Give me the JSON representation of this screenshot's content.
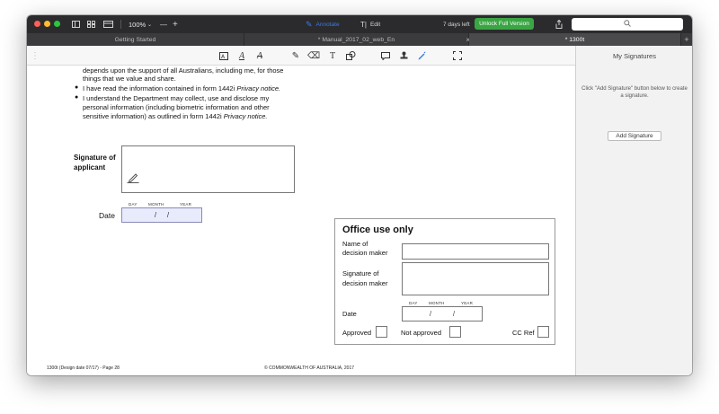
{
  "titlebar": {
    "zoom": "100%",
    "zoom_minus": "—",
    "zoom_plus": "+",
    "annotate_label": "Annotate",
    "edit_label": "Edit",
    "trial_text": "7 days left",
    "unlock_label": "Unlock Full Version",
    "colors": {
      "annotate": "#3c7be0",
      "unlock": "#3aa543"
    }
  },
  "tabs": [
    {
      "label": "Getting Started"
    },
    {
      "label": "* Manual_2017_02_web_En"
    },
    {
      "label": "* 1300t"
    }
  ],
  "tab_close": "×",
  "tab_add": "+",
  "document": {
    "para1_line1": "depends upon the support of all Australians, including me, for those",
    "para1_line2": "things that we value and share.",
    "bullet_char": "●",
    "bullet2_prefix": "I have read the information contained in form 1442i ",
    "bullet2_italic": "Privacy notice.",
    "bullet3_line1": "I understand the Department may collect, use and disclose my",
    "bullet3_line2": "personal information (including biometric information and other",
    "bullet3_line3_prefix": "sensitive information) as outlined in form 1442i ",
    "bullet3_line3_italic": "Privacy notice.",
    "signature_label_1": "Signature of",
    "signature_label_2": "applicant",
    "date_headers": {
      "day": "DAY",
      "month": "MONTH",
      "year": "YEAR"
    },
    "date_label": "Date",
    "date_slash": "/",
    "office": {
      "title": "Office use only",
      "name_label_1": "Name of",
      "name_label_2": "decision maker",
      "sig_label_1": "Signature of",
      "sig_label_2": "decision maker",
      "date_label": "Date",
      "approved": "Approved",
      "not_approved": "Not approved",
      "cc_ref": "CC Ref"
    },
    "footer_left": "1300t (Design date 07/17) - Page 28",
    "footer_center": "© COMMONWEALTH OF AUSTRALIA, 2017"
  },
  "sidebar": {
    "title": "My Signatures",
    "hint": "Click \"Add Signature\" button below to create a signature.",
    "add_button": "Add Signature"
  }
}
